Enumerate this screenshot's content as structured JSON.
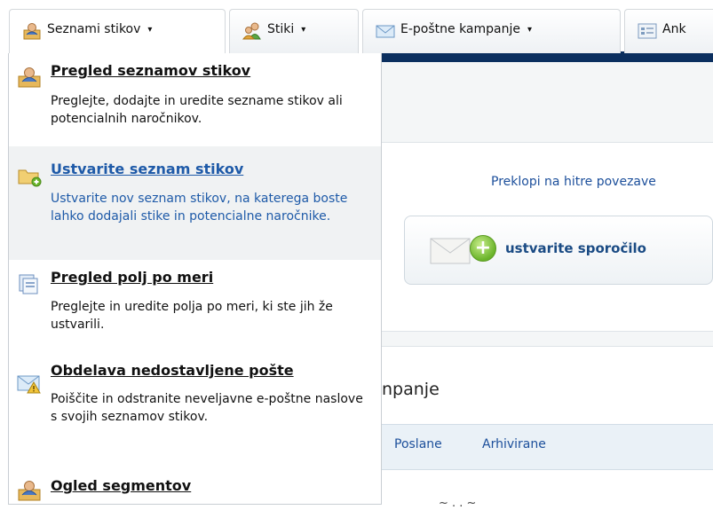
{
  "nav": {
    "tabs": [
      {
        "label": "Seznami stikov",
        "icon": "contact-lists-icon"
      },
      {
        "label": "Stiki",
        "icon": "contacts-icon"
      },
      {
        "label": "E-poštne kampanje",
        "icon": "email-campaigns-icon"
      },
      {
        "label": "Ank",
        "icon": "surveys-icon"
      }
    ],
    "caret": "▾"
  },
  "menu": {
    "items": [
      {
        "title": "Pregled seznamov stikov",
        "description": "Preglejte, dodajte in uredite sezname stikov ali potencialnih naročnikov.",
        "icon": "contact-list-icon"
      },
      {
        "title": "Ustvarite seznam stikov",
        "description": "Ustvarite nov seznam stikov, na katerega boste lahko dodajali stike in potencialne naročnike.",
        "icon": "new-folder-icon"
      },
      {
        "title": "Pregled polj po meri",
        "description": "Preglejte in uredite polja po meri, ki ste jih že ustvarili.",
        "icon": "custom-fields-icon"
      },
      {
        "title": "Obdelava nedostavljene pošte",
        "description": "Poiščite in odstranite neveljavne e-poštne naslove s svojih seznamov stikov.",
        "icon": "undelivered-mail-icon"
      },
      {
        "title": "Ogled segmentov",
        "description": "",
        "icon": "segments-icon"
      }
    ]
  },
  "page": {
    "quick_links_toggle": "Preklopi na hitre povezave",
    "create_message": "ustvarite sporočilo",
    "create_plus": "+",
    "campaigns_heading": "npanje",
    "subtabs": [
      "Poslane",
      "Arhivirane"
    ],
    "cut_text": "~ . . ~"
  },
  "colors": {
    "nav_bar": "#0b2f5f",
    "link": "#1c4f9b",
    "hover_link": "#1e5aa8"
  }
}
